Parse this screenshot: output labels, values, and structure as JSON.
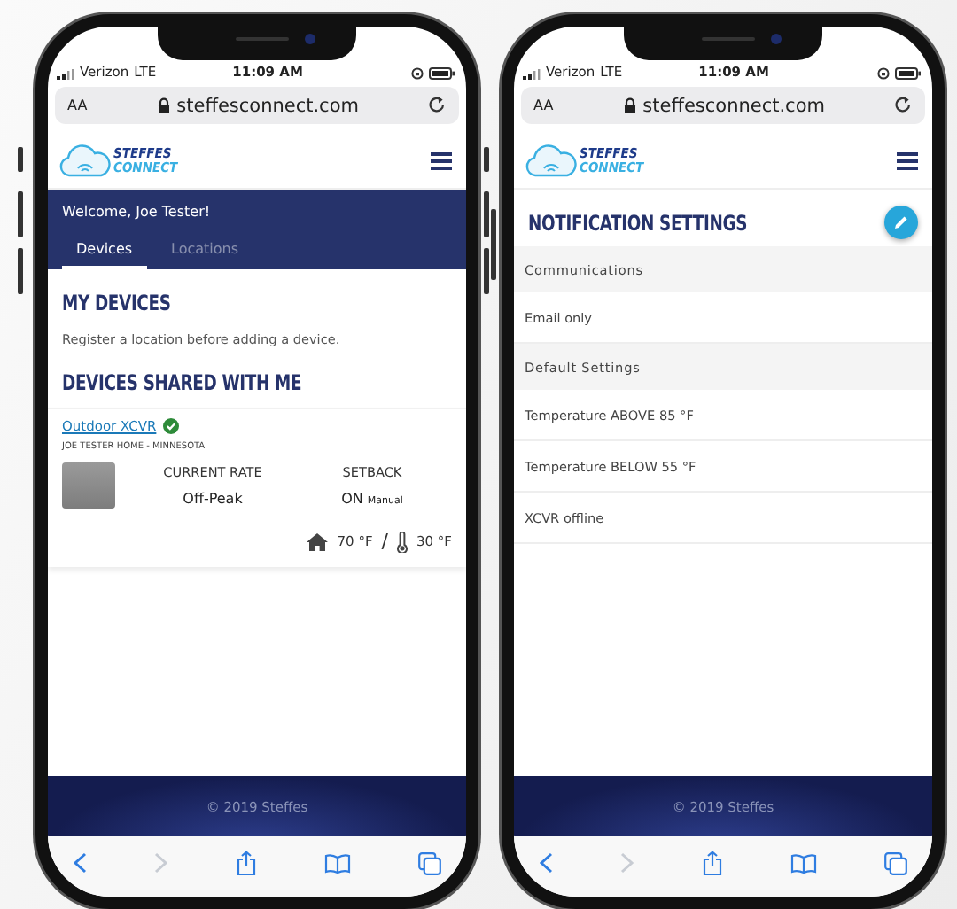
{
  "phones": [
    {
      "status_bar": {
        "carrier": "Verizon",
        "network": "LTE",
        "time": "11:09 AM"
      },
      "browser": {
        "text_size": "AA",
        "url": "steffesconnect.com",
        "can_go_forward": false
      },
      "logo": {
        "line1": "STEFFES",
        "line2": "CONNECT"
      },
      "screen": {
        "kind": "devices",
        "welcome": "Welcome, Joe Tester!",
        "tabs": [
          {
            "label": "Devices",
            "selected": true
          },
          {
            "label": "Locations",
            "selected": false
          }
        ],
        "my_devices_title": "MY DEVICES",
        "my_devices_note": "Register a location before adding a device.",
        "shared_title": "DEVICES SHARED WITH ME",
        "device": {
          "name": "Outdoor XCVR",
          "online": true,
          "location": "JOE TESTER HOME - MINNESOTA",
          "rate_label": "CURRENT RATE",
          "rate": "Off-Peak",
          "setback_label": "SETBACK",
          "setback": "ON",
          "setback_mode": "Manual",
          "indoor_temp": "70 °F",
          "separator": "/",
          "outdoor_temp": "30 °F"
        }
      },
      "footer": "© 2019 Steffes"
    },
    {
      "status_bar": {
        "carrier": "Verizon",
        "network": "LTE",
        "time": "11:09 AM"
      },
      "browser": {
        "text_size": "AA",
        "url": "steffesconnect.com",
        "can_go_forward": false
      },
      "logo": {
        "line1": "STEFFES",
        "line2": "CONNECT"
      },
      "screen": {
        "kind": "notifications",
        "title": "NOTIFICATION SETTINGS",
        "rows": [
          {
            "kind": "header",
            "text": "Communications"
          },
          {
            "kind": "item",
            "text": "Email only"
          },
          {
            "kind": "header",
            "text": "Default Settings"
          },
          {
            "kind": "item",
            "text": "Temperature ABOVE 85 °F"
          },
          {
            "kind": "item",
            "text": "Temperature BELOW 55 °F"
          },
          {
            "kind": "item",
            "text": "XCVR offline"
          }
        ]
      },
      "footer": "© 2019 Steffes"
    }
  ]
}
